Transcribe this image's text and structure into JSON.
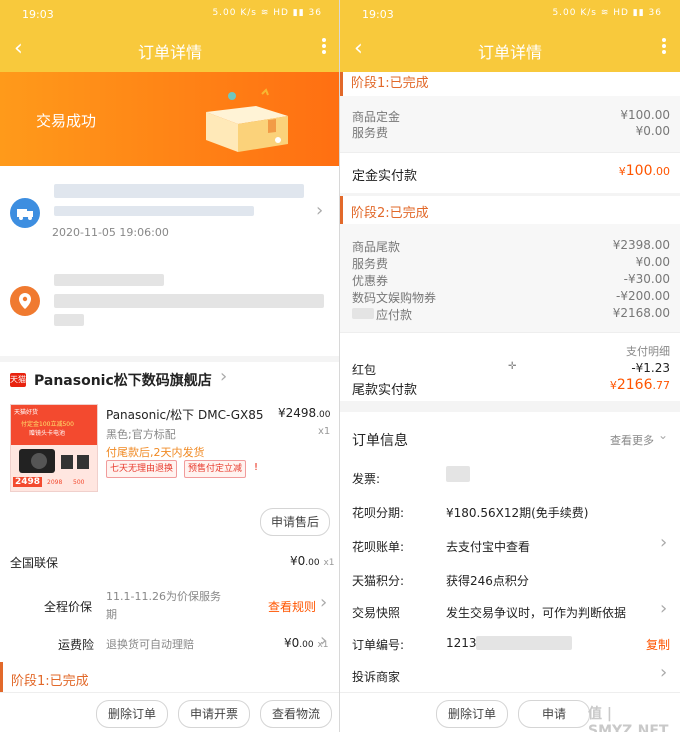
{
  "status": {
    "time": "19:03",
    "icons": "5.00 K/s  ≋  HD  ▮▮  36"
  },
  "left": {
    "nav": {
      "title": "订单详情"
    },
    "success_text": "交易成功",
    "logistics_time": "2020-11-05 19:06:00",
    "store": {
      "badge": "天猫",
      "name": "Panasonic松下数码旗舰店"
    },
    "product": {
      "title": "Panasonic/松下 DMC-GX85",
      "price_symbol": "¥",
      "price": "2498",
      "price_dec": ".00",
      "qty": "x1",
      "spec": "黑色;官方标配",
      "ship": "付尾款后,2天内发货",
      "tag1": "七天无理由退换",
      "tag2": "预售付定立减",
      "tag_warn": "!",
      "thumb_price": "2498",
      "thumb_tag": "天猫好货",
      "thumb_line1": "付定金100立减500",
      "thumb_line2": "赠镜头卡电池",
      "thumb_b1": "2098",
      "thumb_b2": "500",
      "after_sale_button": "申请售后"
    },
    "services": [
      {
        "label": "全国联保",
        "value_symbol": "¥",
        "value": "0",
        "value_dec": ".00",
        "qty": "x1"
      },
      {
        "label": "全程价保",
        "desc": "11.1-11.26为价保服务期",
        "desc1": "11.1-11.26为价保服务",
        "desc2": "期",
        "link": "查看规则",
        "chev": "›"
      },
      {
        "label": "运费险",
        "desc": "退换货可自动理赔",
        "value_symbol": "¥",
        "value": "0",
        "value_dec": ".00",
        "qty": "x1"
      }
    ],
    "stage1_title": "阶段1:已完成",
    "buttons": {
      "delete": "删除订单",
      "invoice": "申请开票",
      "logistics": "查看物流"
    }
  },
  "right": {
    "nav": {
      "title": "订单详情"
    },
    "stage1": {
      "title": "阶段1:已完成",
      "rows": [
        {
          "label": "商品定金",
          "value": "¥100.00"
        },
        {
          "label": "服务费",
          "value": "¥0.00"
        }
      ],
      "paid_label": "定金实付款",
      "paid_symbol": "¥",
      "paid_int": "100",
      "paid_dec": ".00"
    },
    "stage2": {
      "title": "阶段2:已完成",
      "rows": [
        {
          "label": "商品尾款",
          "value": "¥2398.00"
        },
        {
          "label": "服务费",
          "value": "¥0.00"
        },
        {
          "label": "优惠券",
          "value": "-¥30.00"
        },
        {
          "label": "数码文娱购物券",
          "value": "-¥200.00"
        },
        {
          "label": "应付款",
          "value": "¥2168.00"
        }
      ],
      "pay_detail": "支付明细",
      "redpacket_label": "红包",
      "redpacket_value": "-¥1.23",
      "paid_label": "尾款实付款",
      "paid_symbol": "¥",
      "paid_int": "2166",
      "paid_dec": ".77"
    },
    "order_info": {
      "title": "订单信息",
      "more": "查看更多",
      "rows": [
        {
          "label": "发票:",
          "value": ""
        },
        {
          "label": "花呗分期:",
          "value": "¥180.56X12期(免手续费)"
        },
        {
          "label": "花呗账单:",
          "value": "去支付宝中查看"
        },
        {
          "label": "天猫积分:",
          "value": "获得246点积分"
        },
        {
          "label": "交易快照",
          "value": "发生交易争议时，可作为判断依据"
        },
        {
          "label": "订单编号:",
          "value": "1213"
        },
        {
          "label": "投诉商家",
          "value": ""
        }
      ],
      "copy": "复制"
    },
    "buttons": {
      "delete": "删除订单",
      "invoice": "申请"
    },
    "watermark": "值 | SMYZ.NET"
  },
  "colors": {
    "bar": "#f8c93c",
    "accent": "#ff5500",
    "stage": "#e2692a"
  }
}
